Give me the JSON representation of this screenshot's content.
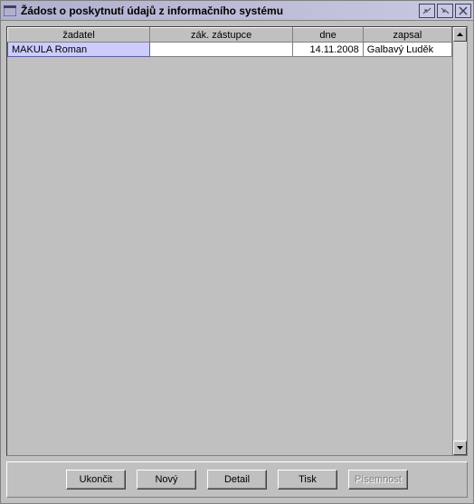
{
  "window": {
    "title": "Žádost o poskytnutí údajů z informačního systému"
  },
  "table": {
    "headers": {
      "applicant": "žadatel",
      "representative": "zák. zástupce",
      "date": "dne",
      "recorder": "zapsal"
    },
    "rows": [
      {
        "applicant": "MAKULA Roman",
        "representative": "",
        "date": "14.11.2008",
        "recorder": "Galbavý Luděk"
      }
    ]
  },
  "buttons": {
    "close": "Ukončit",
    "new": "Nový",
    "detail": "Detail",
    "print": "Tisk",
    "document": "Písemnost"
  },
  "icons": {
    "window": "window-icon",
    "minmax": "minmax-icon",
    "restore": "restore-icon",
    "close": "close-icon"
  }
}
